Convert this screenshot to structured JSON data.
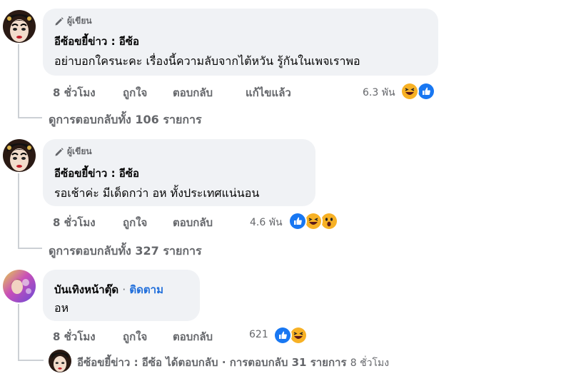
{
  "comments": [
    {
      "badge": "ผู้เขียน",
      "author": "อีซ้อขยี้ข่าว : อีซ้อ",
      "text": "อย่าบอกใครนะคะ เรื่องนี้ความลับจากไต้หวัน รู้กันในเพจเราพอ",
      "time": "8 ชั่วโมง",
      "like": "ถูกใจ",
      "reply": "ตอบกลับ",
      "edited": "แก้ไขแล้ว",
      "reaction_count": "6.3 พัน",
      "reactions": [
        "haha-icon",
        "like-icon"
      ],
      "view_replies": "ดูการตอบกลับทั้ง 106 รายการ"
    },
    {
      "badge": "ผู้เขียน",
      "author": "อีซ้อขยี้ข่าว : อีซ้อ",
      "text": "รอเช้าค่ะ มีเด็ดกว่า อห ทั้งประเทศแน่นอน",
      "time": "8 ชั่วโมง",
      "like": "ถูกใจ",
      "reply": "ตอบกลับ",
      "reaction_count": "4.6 พัน",
      "reactions": [
        "like-icon",
        "haha-icon",
        "wow-icon"
      ],
      "view_replies": "ดูการตอบกลับทั้ง 327 รายการ"
    },
    {
      "author": "บันเทิงหน้าตุ๊ด",
      "separator": "·",
      "follow": "ติดตาม",
      "text": "อห",
      "time": "8 ชั่วโมง",
      "like": "ถูกใจ",
      "reply": "ตอบกลับ",
      "reaction_count": "621",
      "reactions": [
        "like-icon",
        "haha-icon"
      ],
      "reply_summary": {
        "author": "อีซ้อขยี้ข่าว : อีซ้อ",
        "action": "ได้ตอบกลับ",
        "separator": "·",
        "count": "การตอบกลับ 31 รายการ",
        "time": "8 ชั่วโมง"
      }
    }
  ],
  "colors": {
    "bubble": "#f0f2f5",
    "secondary_text": "#65676b",
    "link_blue": "#216fdb",
    "like_blue": "#1877f2",
    "haha_yellow": "#f7b125"
  }
}
